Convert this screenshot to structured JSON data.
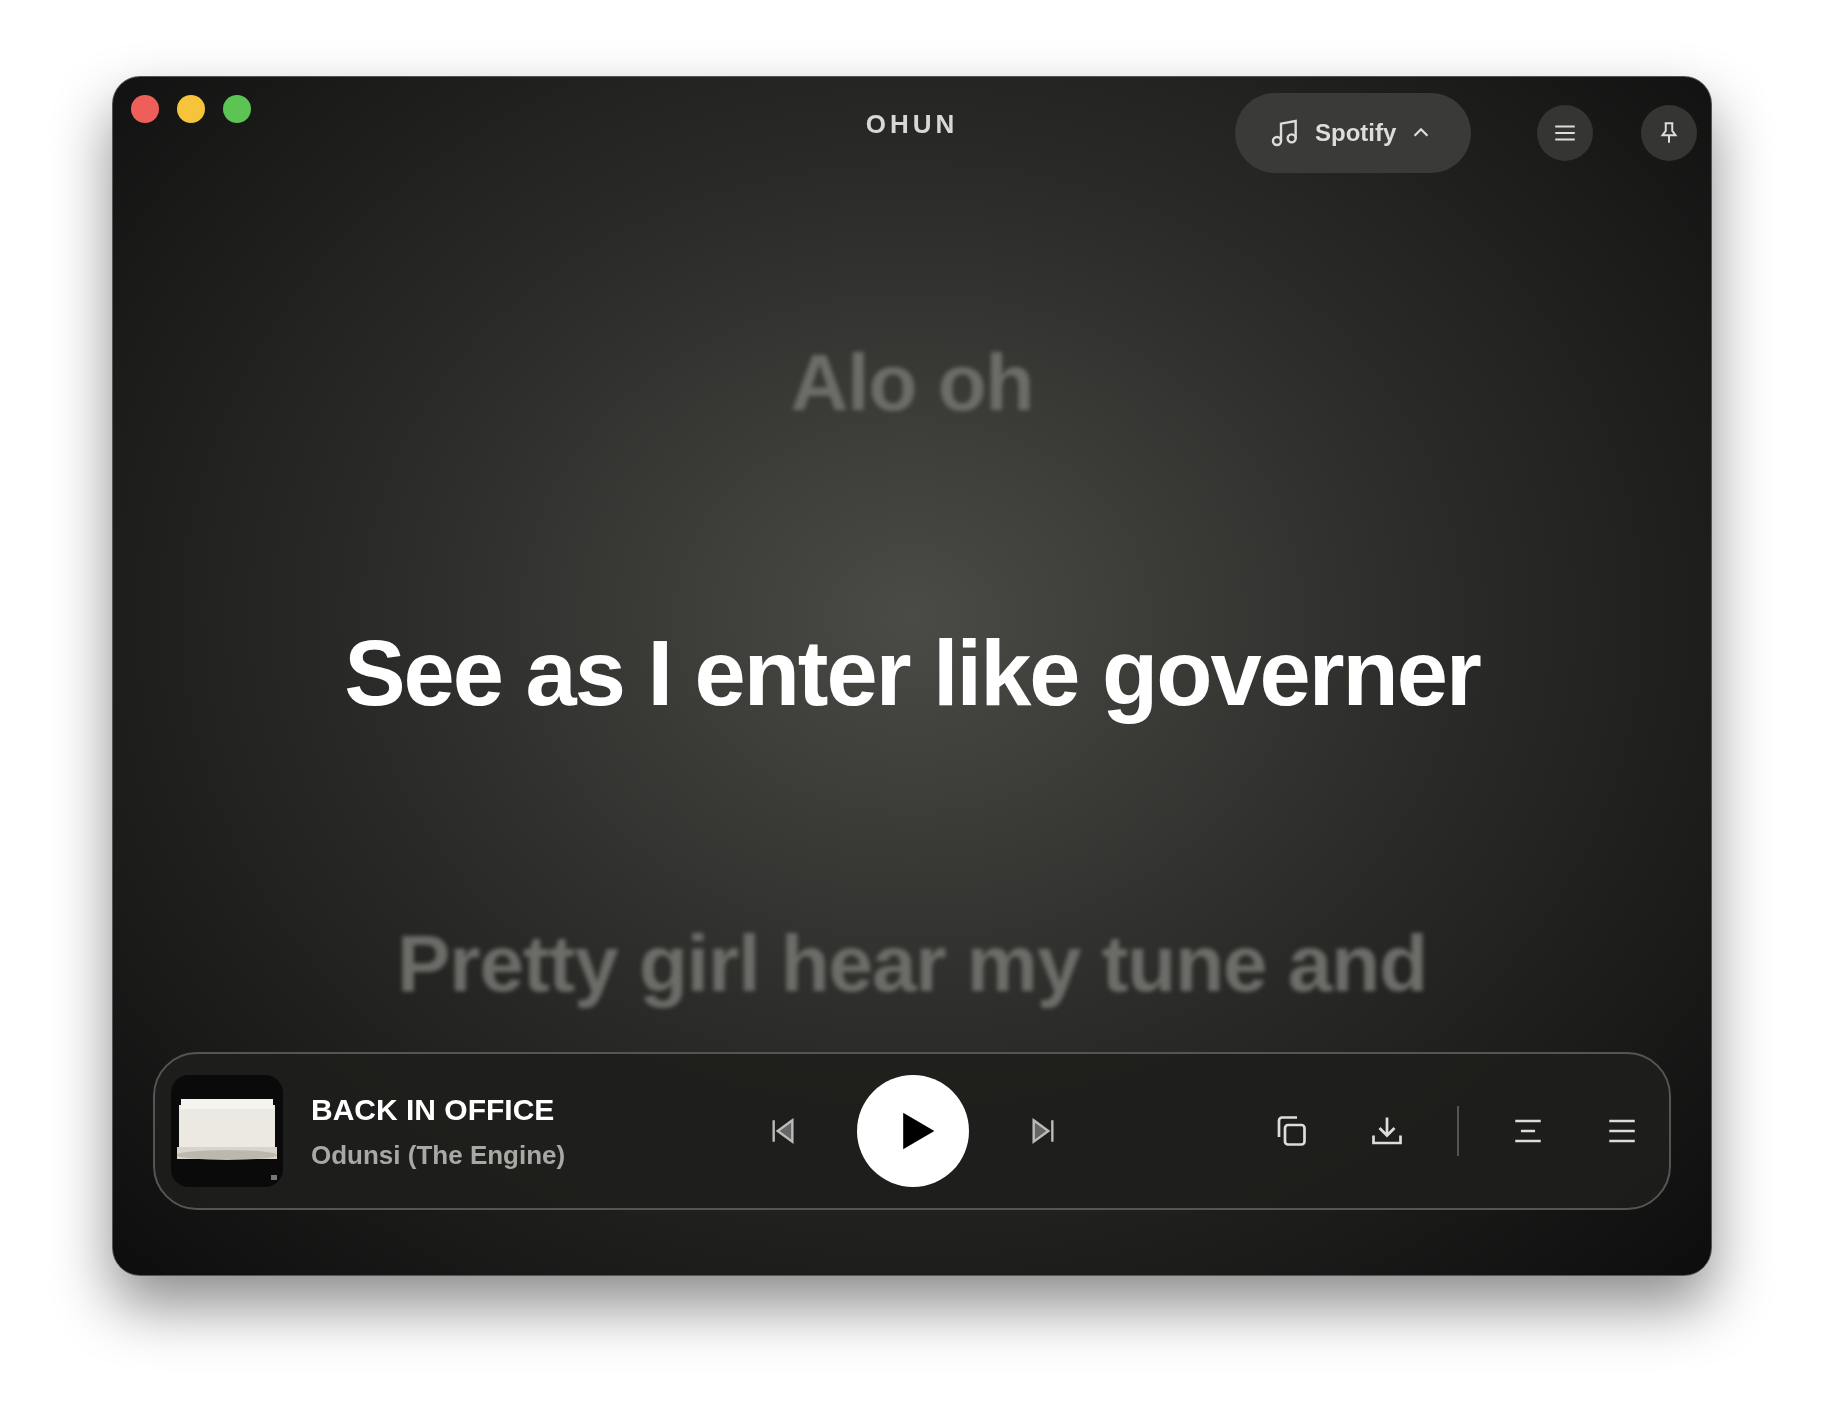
{
  "window": {
    "title": "OHUN"
  },
  "source_picker": {
    "label": "Spotify"
  },
  "lyrics": [
    {
      "text": "Alo oh",
      "active": false
    },
    {
      "text": "See as I enter like governer",
      "active": true
    },
    {
      "text": "Pretty girl hear my tune and",
      "active": false
    }
  ],
  "now_playing": {
    "title": "BACK IN OFFICE",
    "artist": "Odunsi (The Engine)",
    "playing": false
  }
}
